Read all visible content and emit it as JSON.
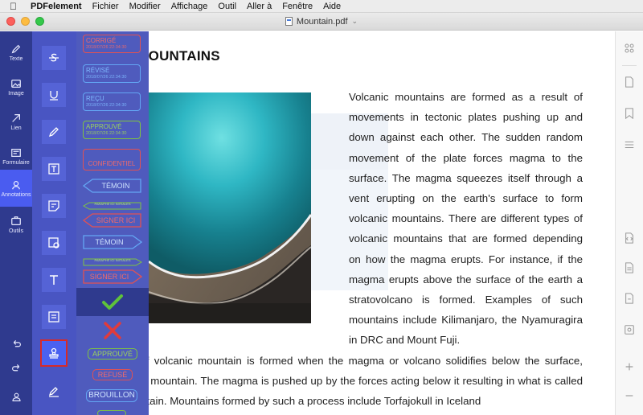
{
  "menubar": {
    "apple": "",
    "items": [
      "PDFelement",
      "Fichier",
      "Modifier",
      "Affichage",
      "Outil",
      "Aller à",
      "Fenêtre",
      "Aide"
    ]
  },
  "window": {
    "doc_title": "Mountain.pdf"
  },
  "sidebar": {
    "items": [
      {
        "label": "Texte",
        "icon": "pencil-icon"
      },
      {
        "label": "Image",
        "icon": "image-icon"
      },
      {
        "label": "Lien",
        "icon": "link-icon"
      },
      {
        "label": "Formulaire",
        "icon": "form-icon"
      },
      {
        "label": "Annotations",
        "icon": "annotation-icon",
        "active": true
      },
      {
        "label": "Outils",
        "icon": "tools-icon"
      }
    ]
  },
  "stamps": {
    "corrige": {
      "label": "CORRIGÉ",
      "date": "2018/07/26 22:34:30"
    },
    "revise": {
      "label": "RÉVISÉ",
      "date": "2018/07/26 22:34:30"
    },
    "recu": {
      "label": "REÇU",
      "date": "2018/07/26 22:34:30"
    },
    "approuve_dated": {
      "label": "APPROUVÉ",
      "date": "2018/07/26 22:34:30"
    },
    "confidentiel": "CONFIDENTIEL",
    "temoin_left": "TÉMOIN",
    "initiales_left": "PARAPHE ICI INITIALES",
    "signer_left": "SIGNER ICI",
    "temoin_right": "TÉMOIN",
    "initiales_right": "PARAPHE ICI INITIALES",
    "signer_right": "SIGNER ICI",
    "approuve": "APPROUVÉ",
    "refuse": "REFUSÉ",
    "brouillon": "BROUILLON"
  },
  "colors": {
    "sidebar_bg": "#2f3a8e",
    "tool_bg": "#4955c2",
    "active": "#4a5cf0",
    "stamp_red": "#e25252",
    "stamp_blue": "#63a6f4",
    "stamp_green": "#7fc441",
    "highlight_border": "#d52a2a"
  },
  "document": {
    "heading": "VOLCANIC MOUNTAINS",
    "para1": "Volcanic mountains are formed as a result of movements in tectonic plates pushing up and down against each other. The sudden random movement of the plate forces magma to the surface. The magma squeezes itself through a vent erupting on the earth's surface to form volcanic mountains. There are different types of volcanic mountains that are formed depending on how the magma erupts. For instance, if the magma erupts above the surface of the earth a stratovolcano is formed. Examples of such mountains include Kilimanjaro, the Nyamuragira in DRC and Mount Fuji.",
    "para2": "Another type of volcanic mountain is formed when the magma or volcano solidifies below the surface, forming a dome mountain. The magma is pushed up by the forces acting below it resulting in what is called the dome mountain. Mountains formed by such a process include Torfajokull in Iceland"
  }
}
